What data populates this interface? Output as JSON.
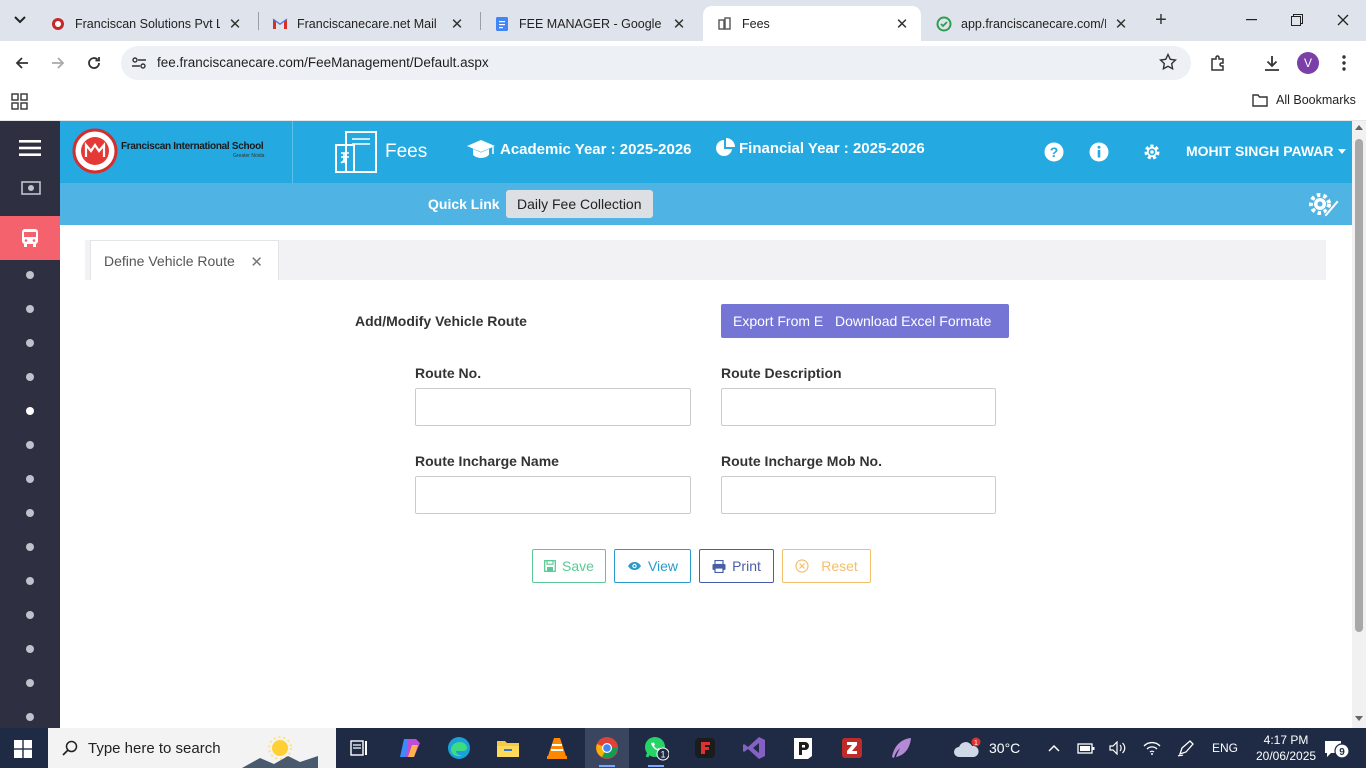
{
  "browser": {
    "tabs": [
      {
        "title": "Franciscan Solutions Pvt Ltd.",
        "icon": "franciscan-favicon"
      },
      {
        "title": "Franciscanecare.net Mail",
        "icon": "gmail-favicon"
      },
      {
        "title": "FEE MANAGER - Google Docs",
        "icon": "google-docs-favicon"
      },
      {
        "title": "Fees",
        "icon": "fees-favicon"
      },
      {
        "title": "app.franciscanecare.com/Po",
        "icon": "app-favicon"
      }
    ],
    "url": "fee.franciscanecare.com/FeeManagement/Default.aspx",
    "profile_initial": "V",
    "bookmarks_label": "All Bookmarks"
  },
  "app": {
    "school_name": "Franciscan International School",
    "school_sub": "Greater Noida",
    "module": "Fees",
    "academic_year": "Academic Year : 2025-2026",
    "financial_year": "Financial Year : 2025-2026",
    "user": "MOHIT SINGH PAWAR",
    "quick_link_label": "Quick Link",
    "quick_link_btn": "Daily Fee Collection",
    "accent": "#24a9e1",
    "sidebar_active_color": "#f4626d"
  },
  "page": {
    "tab_title": "Define Vehicle Route",
    "section_title": "Add/Modify Vehicle Route",
    "export_btn_a": "Export From Excel",
    "export_btn_b": "Download Excel Formate",
    "fields": {
      "route_no": {
        "label": "Route No.",
        "value": ""
      },
      "route_desc": {
        "label": "Route Description",
        "value": ""
      },
      "incharge_name": {
        "label": "Route Incharge Name",
        "value": ""
      },
      "incharge_mob": {
        "label": "Route Incharge Mob No.",
        "value": ""
      }
    },
    "buttons": {
      "save": "Save",
      "view": "View",
      "print": "Print",
      "reset": "Reset"
    }
  },
  "taskbar": {
    "search_placeholder": "Type here to search",
    "temperature": "30°C",
    "lang": "ENG",
    "time": "4:17 PM",
    "date": "20/06/2025",
    "whatsapp_badge": "1",
    "weather_badge": "1",
    "notification_count": "9"
  }
}
